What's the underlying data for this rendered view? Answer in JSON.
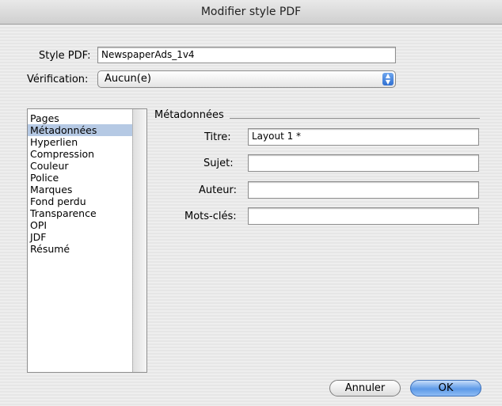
{
  "window": {
    "title": "Modifier style PDF"
  },
  "form": {
    "style_label": "Style PDF:",
    "style_value": "NewspaperAds_1v4",
    "verification_label": "Vérification:",
    "verification_value": "Aucun(e)"
  },
  "sidebar": {
    "items": [
      {
        "label": "Pages"
      },
      {
        "label": "Métadonnées"
      },
      {
        "label": "Hyperlien"
      },
      {
        "label": "Compression"
      },
      {
        "label": "Couleur"
      },
      {
        "label": "Police"
      },
      {
        "label": "Marques"
      },
      {
        "label": "Fond perdu"
      },
      {
        "label": "Transparence"
      },
      {
        "label": "OPI"
      },
      {
        "label": "JDF"
      },
      {
        "label": "Résumé"
      }
    ],
    "selected": "Métadonnées"
  },
  "metadata": {
    "group_title": "Métadonnées",
    "titre_label": "Titre:",
    "titre_value": "Layout 1 *",
    "sujet_label": "Sujet:",
    "sujet_value": "",
    "auteur_label": "Auteur:",
    "auteur_value": "",
    "mots_cles_label": "Mots-clés:",
    "mots_cles_value": ""
  },
  "buttons": {
    "cancel_label": "Annuler",
    "ok_label": "OK"
  },
  "icons": {
    "select_arrows": "updown-chevron-icon"
  }
}
